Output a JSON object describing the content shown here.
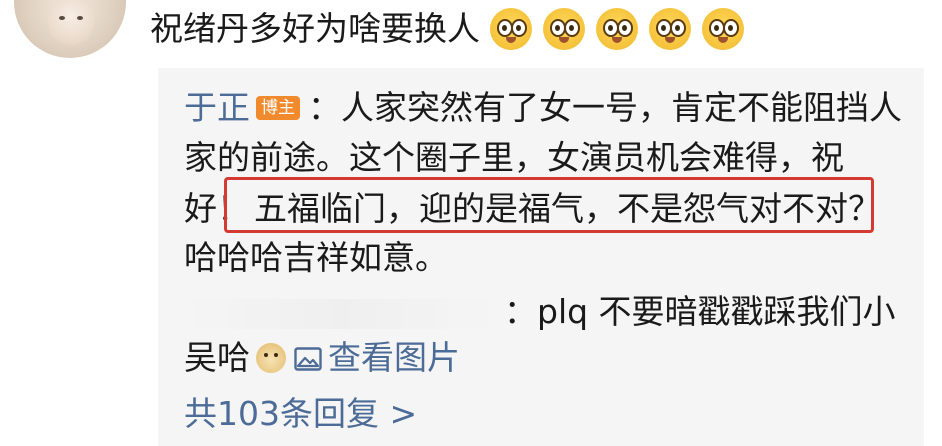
{
  "comment": {
    "text": "祝绪丹多好为啥要换人",
    "emojis": [
      "shy-face-emoji",
      "shy-face-emoji",
      "shy-face-emoji",
      "shy-face-emoji",
      "shy-face-emoji"
    ]
  },
  "reply": {
    "author": "于正",
    "badge": "博主",
    "line1": "：人家突然有了女一号，肯定不能阻挡人",
    "line2": "家的前途。这个圈子里，女演员机会难得，祝",
    "line3_prefix": "好！",
    "line3_highlight": "五福临门，迎的是福气，不是怨气对不对？",
    "line4": "哈哈哈吉祥如意。"
  },
  "sub_reply": {
    "text1": "：plq 不要暗戳戳踩我们小",
    "text2": "吴哈",
    "view_image": "查看图片"
  },
  "more_replies": "共103条回复 >",
  "colors": {
    "link": "#4c6b96",
    "highlight_border": "#d33a32",
    "badge": "#f08a2c",
    "reply_bg": "#f5f5f5"
  }
}
